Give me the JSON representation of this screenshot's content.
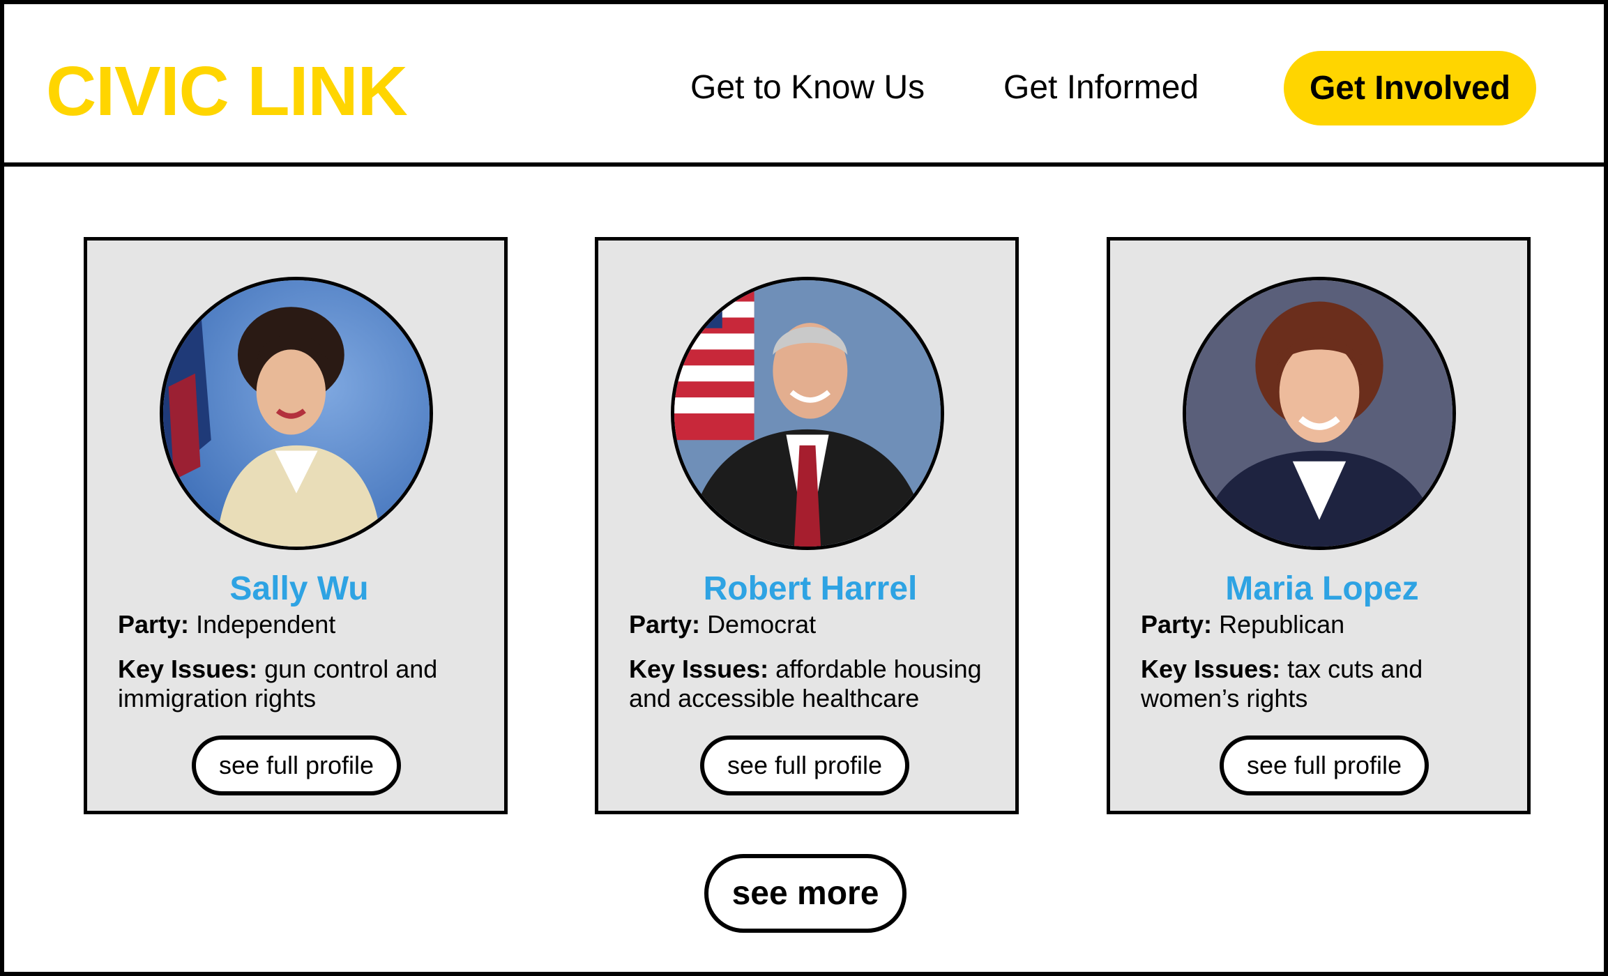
{
  "header": {
    "logo": "CIVIC LINK",
    "nav": [
      {
        "label": "Get to Know Us"
      },
      {
        "label": "Get Informed"
      },
      {
        "label": "Get Involved"
      }
    ]
  },
  "labels": {
    "party": "Party:",
    "issues": "Key Issues:"
  },
  "candidates": [
    {
      "name": "Sally Wu",
      "party": "Independent",
      "issues": "gun control and immigration rights",
      "button": "see full profile"
    },
    {
      "name": "Robert Harrel",
      "party": "Democrat",
      "issues": "affordable housing and accessible healthcare",
      "button": "see full profile"
    },
    {
      "name": "Maria Lopez",
      "party": "Republican",
      "issues": "tax cuts and women’s rights",
      "button": "see full profile"
    }
  ],
  "see_more": "see more",
  "colors": {
    "brand": "#FFD500",
    "name": "#2EA3E3",
    "card_bg": "#E5E5E5"
  }
}
